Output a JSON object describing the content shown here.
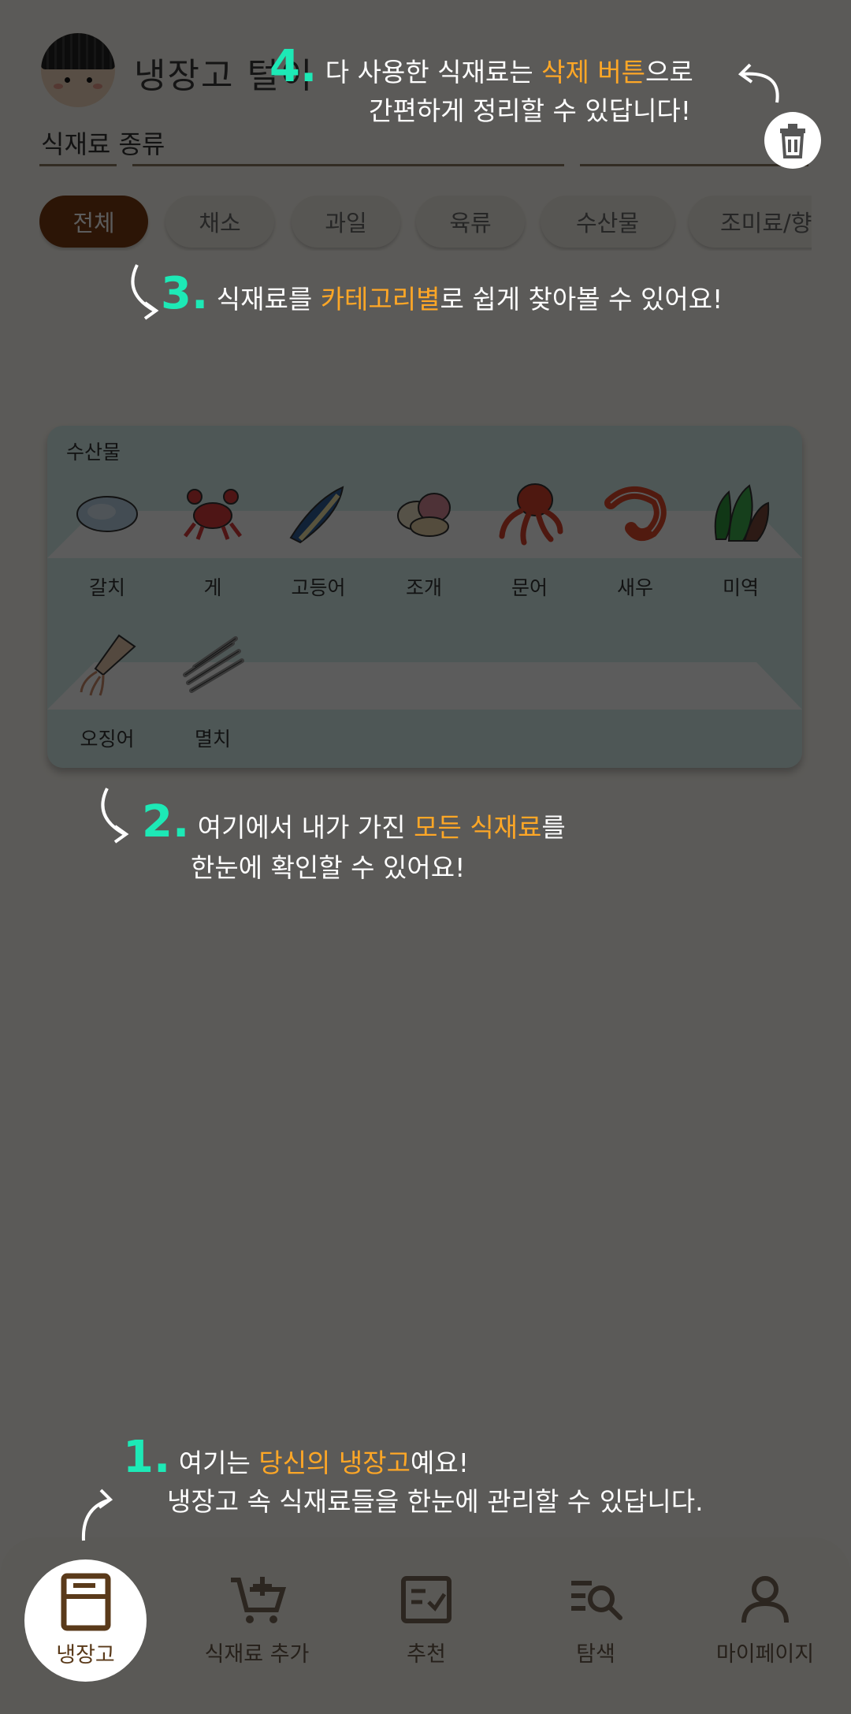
{
  "header": {
    "app_title": "냉장고 털이",
    "filter_label": "식재료 종류"
  },
  "categories": [
    {
      "label": "전체",
      "active": true
    },
    {
      "label": "채소",
      "active": false
    },
    {
      "label": "과일",
      "active": false
    },
    {
      "label": "육류",
      "active": false
    },
    {
      "label": "수산물",
      "active": false
    },
    {
      "label": "조미료/향",
      "active": false
    }
  ],
  "shelf": {
    "title": "수산물",
    "items": [
      "갈치",
      "게",
      "고등어",
      "조개",
      "문어",
      "새우",
      "미역",
      "오징어",
      "멸치"
    ]
  },
  "tips": {
    "t4": {
      "num": "4.",
      "pre": "다 사용한 식재료는 ",
      "hl": "삭제 버튼",
      "post": "으로",
      "line2": "간편하게 정리할 수 있답니다!"
    },
    "t3": {
      "num": "3.",
      "pre": "식재료를 ",
      "hl": "카테고리별",
      "post": "로 쉽게 찾아볼 수 있어요!"
    },
    "t2": {
      "num": "2.",
      "pre": "여기에서 내가 가진 ",
      "hl": "모든 식재료",
      "post": "를",
      "line2": "한눈에 확인할 수 있어요!"
    },
    "t1": {
      "num": "1.",
      "pre": "여기는 ",
      "hl": "당신의 냉장고",
      "post": "예요!",
      "line2": "냉장고 속 식재료들을 한눈에 관리할 수 있답니다."
    }
  },
  "nav": {
    "fridge": "냉장고",
    "add": "식재료 추가",
    "recommend": "추천",
    "search": "탐색",
    "mypage": "마이페이지"
  },
  "colors": {
    "accent": "#7a3b12",
    "tip_number": "#1de9b6",
    "tip_highlight": "#ffa726",
    "shelf_bg": "#d8f1ef"
  }
}
